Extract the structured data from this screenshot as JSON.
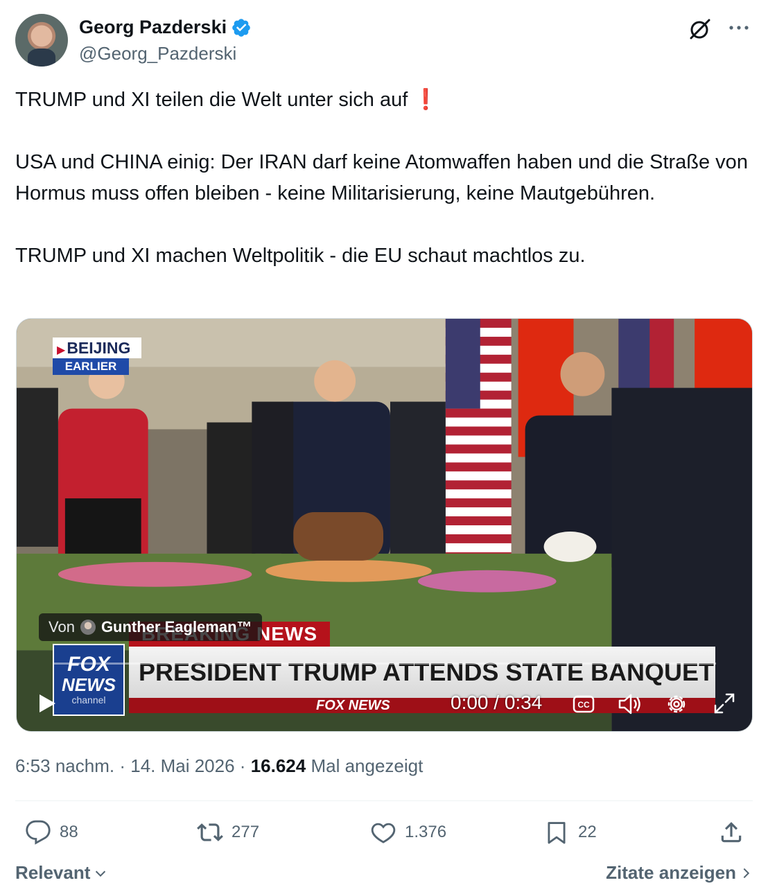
{
  "author": {
    "display_name": "Georg Pazderski",
    "handle": "@Georg_Pazderski",
    "verified_color": "#1d9bf0"
  },
  "tweet": {
    "line1": "TRUMP und XI teilen die Welt unter sich auf",
    "line1_emoji": "❗",
    "para2": "USA und CHINA einig: Der IRAN darf keine Atomwaffen haben und die Straße von Hormus muss offen bleiben - keine Militarisierung, keine Mautgebühren.",
    "para3": "TRUMP und XI machen Weltpolitik - die EU schaut machtlos zu."
  },
  "video": {
    "location_label": "BEIJING",
    "location_sub": "EARLIER",
    "attribution_prefix": "Von",
    "attribution_name": "Gunther Eagleman™",
    "chyron_breaking": "BREAKING NEWS",
    "chyron_headline": "PRESIDENT TRUMP ATTENDS STATE BANQUET WITH XI",
    "chyron_sub": "FOX NEWS",
    "logo_line1": "FOX",
    "logo_line2": "NEWS",
    "logo_line3": "channel",
    "time_display": "0:00 / 0:34",
    "progress": 0
  },
  "meta": {
    "time": "6:53 nachm.",
    "sep1": "·",
    "date": "14. Mai 2026",
    "sep2": "·",
    "views_count": "16.624",
    "views_label": "Mal angezeigt"
  },
  "actions": {
    "replies": "88",
    "reposts": "277",
    "likes": "1.376",
    "bookmarks": "22"
  },
  "footer": {
    "sort_label": "Relevant",
    "quotes_label": "Zitate anzeigen"
  },
  "colors": {
    "text_primary": "#0f1419",
    "text_secondary": "#536471",
    "accent": "#1d9bf0",
    "divider": "#eff3f4"
  }
}
